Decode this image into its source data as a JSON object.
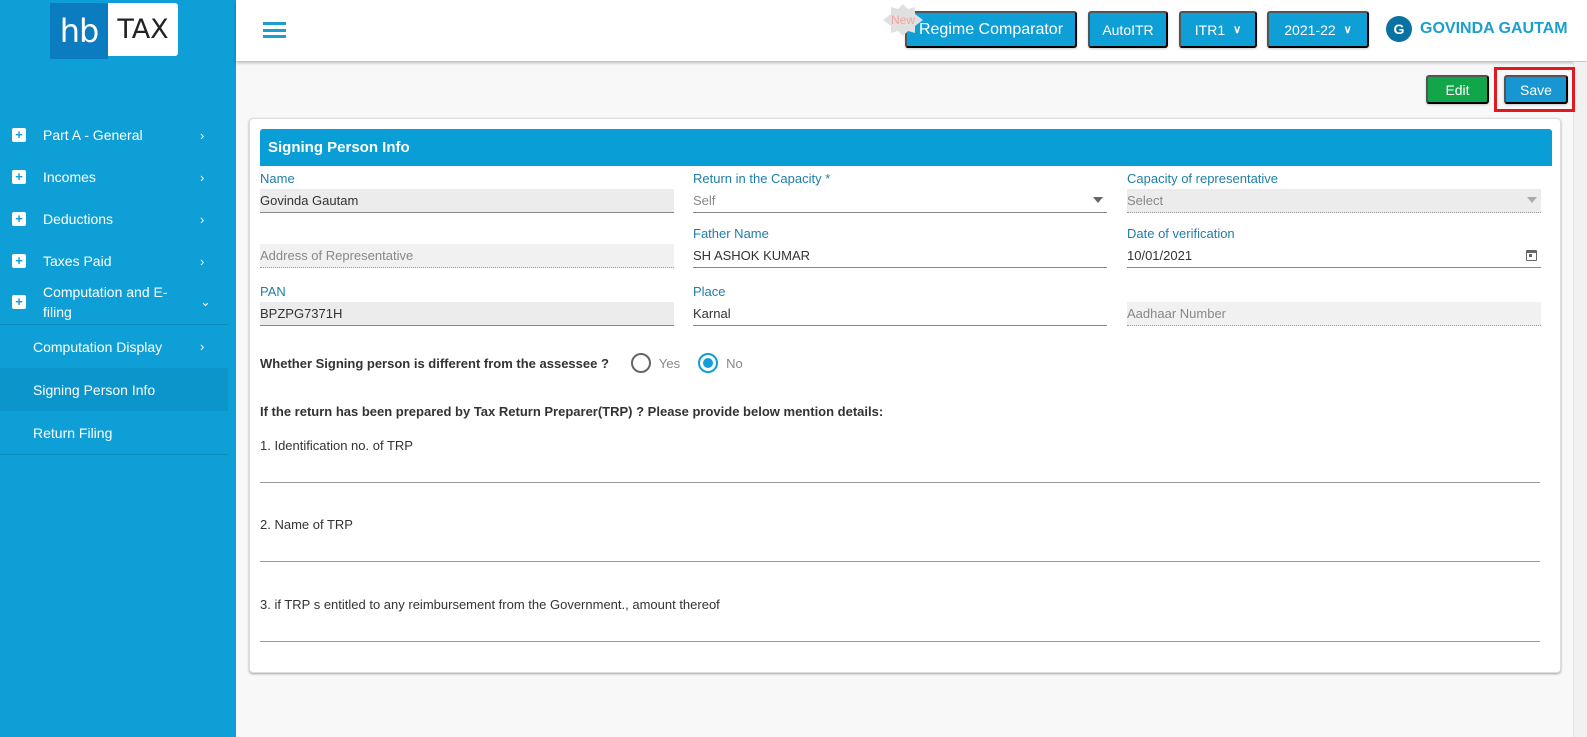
{
  "brand": {
    "logo_left": "hb",
    "logo_right": "TAX"
  },
  "sidebar": {
    "items": [
      {
        "label": "Part A - General",
        "expanded": false
      },
      {
        "label": "Incomes",
        "expanded": false
      },
      {
        "label": "Deductions",
        "expanded": false
      },
      {
        "label": "Taxes Paid",
        "expanded": false
      },
      {
        "label": "Computation and E-filing",
        "expanded": true
      }
    ],
    "sub_items": [
      {
        "label": "Computation Display",
        "active": false
      },
      {
        "label": "Signing Person Info",
        "active": true
      },
      {
        "label": "Return Filing",
        "active": false
      }
    ],
    "icons": {
      "expand": "+",
      "chevron_right": "›",
      "chevron_down": "⌄"
    }
  },
  "topbar": {
    "new_badge": "New",
    "regime_button": "Regime Comparator",
    "autoitr_button": "AutoITR",
    "itr_select": "ITR1",
    "year_select": "2021-22",
    "user_initial": "G",
    "user_name": "GOVINDA GAUTAM"
  },
  "actions": {
    "edit": "Edit",
    "save": "Save"
  },
  "colors": {
    "brand": "#0e9fd6",
    "edit": "#12a64a",
    "save": "#1896d1",
    "highlight": "#e2191e"
  },
  "form": {
    "title": "Signing Person Info",
    "fields": {
      "name": {
        "label": "Name",
        "value": "Govinda  Gautam"
      },
      "capacity": {
        "label": "Return in the Capacity *",
        "value": "Self"
      },
      "rep_capacity": {
        "label": "Capacity of representative",
        "value": "Select"
      },
      "address": {
        "label": "",
        "placeholder": "Address of Representative"
      },
      "father": {
        "label": "Father Name",
        "value": "SH ASHOK KUMAR"
      },
      "date": {
        "label": "Date of verification",
        "value": "10/01/2021"
      },
      "pan": {
        "label": "PAN",
        "value": "BPZPG7371H"
      },
      "place": {
        "label": "Place",
        "value": "Karnal"
      },
      "aadhaar": {
        "label": "",
        "placeholder": "Aadhaar Number"
      }
    },
    "question": {
      "label": "Whether Signing person is different from the assessee ?",
      "options": [
        "Yes",
        "No"
      ],
      "selected": "No"
    },
    "trp_note": "If the return has been prepared by Tax Return Preparer(TRP) ? Please provide below mention details:",
    "trp_fields": [
      {
        "label": "1. Identification no. of TRP",
        "value": ""
      },
      {
        "label": "2. Name of TRP",
        "value": ""
      },
      {
        "label": "3. if TRP s entitled to any reimbursement from the Government., amount thereof",
        "value": ""
      }
    ]
  }
}
